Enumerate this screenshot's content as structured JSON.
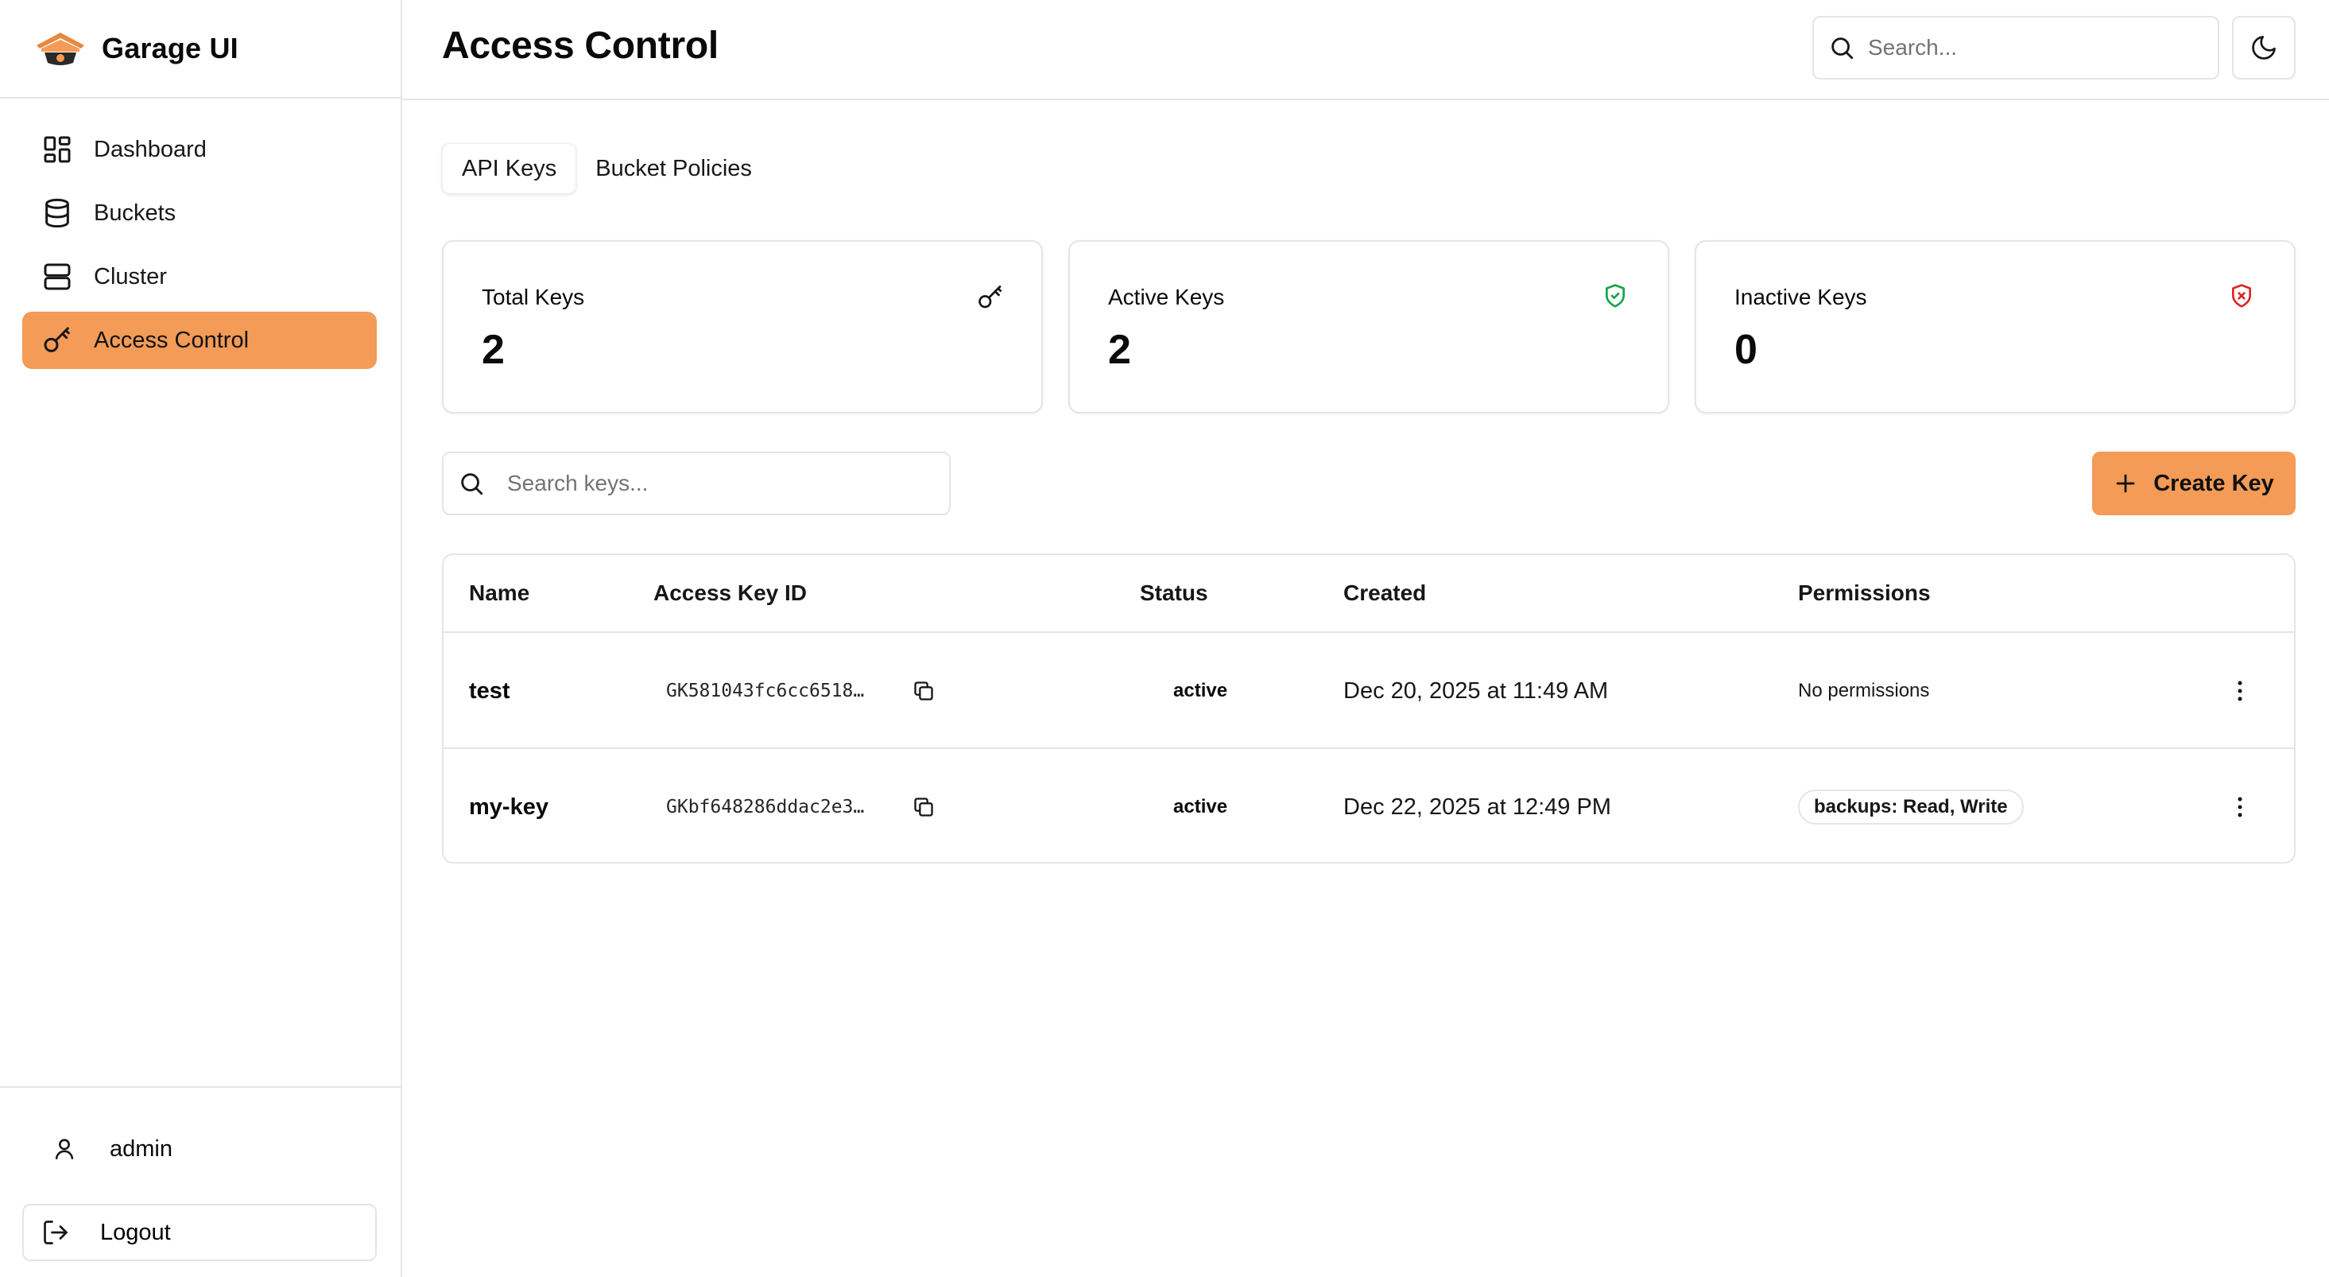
{
  "app": {
    "name": "Garage UI"
  },
  "sidebar": {
    "items": [
      {
        "label": "Dashboard",
        "icon": "dashboard-icon"
      },
      {
        "label": "Buckets",
        "icon": "database-icon"
      },
      {
        "label": "Cluster",
        "icon": "server-icon"
      },
      {
        "label": "Access Control",
        "icon": "key-icon",
        "active": true
      }
    ],
    "user": {
      "name": "admin"
    },
    "logout_label": "Logout"
  },
  "header": {
    "title": "Access Control",
    "search_placeholder": "Search..."
  },
  "tabs": [
    {
      "label": "API Keys",
      "active": true
    },
    {
      "label": "Bucket Policies"
    }
  ],
  "stats": [
    {
      "label": "Total Keys",
      "value": "2",
      "icon": "key-icon"
    },
    {
      "label": "Active Keys",
      "value": "2",
      "icon": "shield-check-icon",
      "color": "#16a34a"
    },
    {
      "label": "Inactive Keys",
      "value": "0",
      "icon": "shield-x-icon",
      "color": "#dc2626"
    }
  ],
  "keys_search": {
    "placeholder": "Search keys..."
  },
  "create_button": {
    "label": "Create Key"
  },
  "table": {
    "columns": [
      "Name",
      "Access Key ID",
      "Status",
      "Created",
      "Permissions"
    ],
    "rows": [
      {
        "name": "test",
        "access_key_id": "GK581043fc6cc6518…",
        "status": "active",
        "created": "Dec 20, 2025 at 11:49 AM",
        "permissions": "No permissions"
      },
      {
        "name": "my-key",
        "access_key_id": "GKbf648286ddac2e3…",
        "status": "active",
        "created": "Dec 22, 2025 at 12:49 PM",
        "permissions": "backups: Read, Write"
      }
    ]
  },
  "colors": {
    "accent": "#f39b57",
    "border": "#e5e5e5",
    "success": "#16a34a",
    "danger": "#dc2626"
  }
}
